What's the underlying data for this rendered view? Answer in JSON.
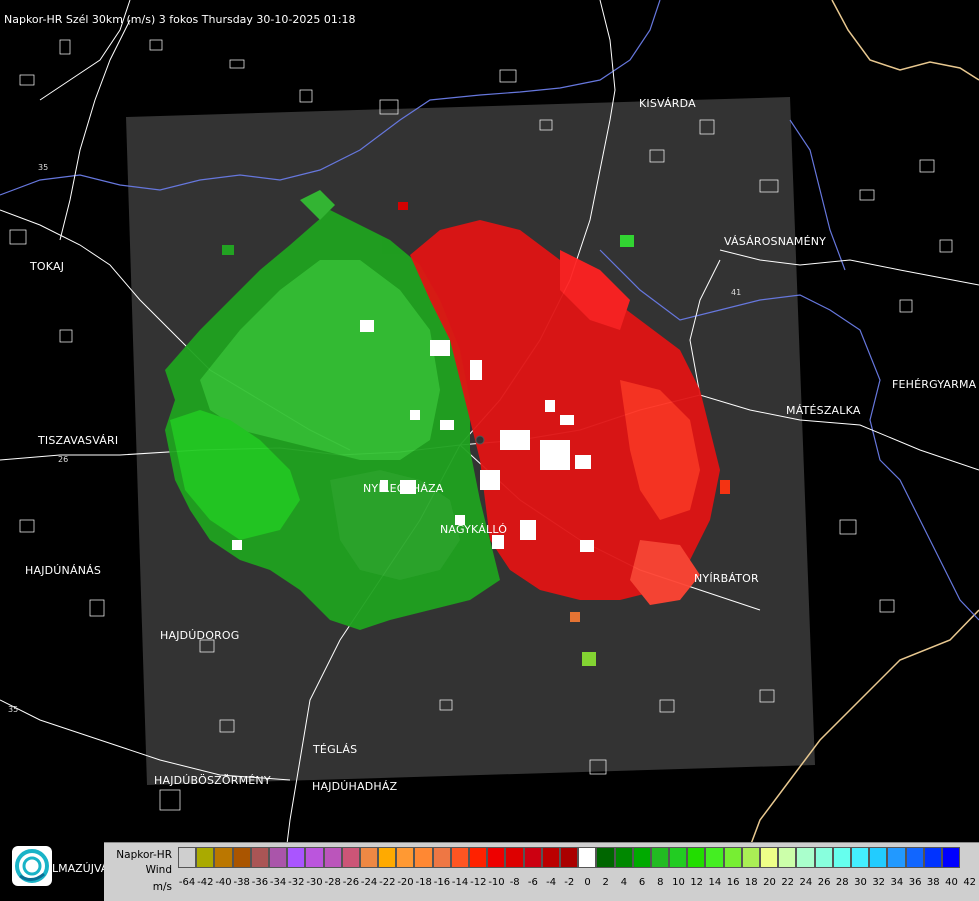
{
  "header": {
    "title": "Napkor-HR Szél 30km (m/s) 3 fokos Thursday 30-10-2025 01:18"
  },
  "cities": [
    {
      "id": "kisvarda",
      "label": "KISVÁRDA"
    },
    {
      "id": "tokaj",
      "label": "TOKAJ"
    },
    {
      "id": "vasarosnameny",
      "label": "VÁSÁROSNAMÉNY"
    },
    {
      "id": "fehergyarmat",
      "label": "FEHÉRGYARMA"
    },
    {
      "id": "mateszalka",
      "label": "MÁTÉSZALKA"
    },
    {
      "id": "tiszavasvari",
      "label": "TISZAVASVÁRI"
    },
    {
      "id": "nyiregyhaza",
      "label": "NYÍREGYHÁZA"
    },
    {
      "id": "nagykallo",
      "label": "NAGYKÁLLÓ"
    },
    {
      "id": "hajdunanas",
      "label": "HAJDÚNÁNÁS"
    },
    {
      "id": "nyirbator",
      "label": "NYÍRBÁTOR"
    },
    {
      "id": "hajdudorog",
      "label": "HAJDÚDOROG"
    },
    {
      "id": "teglas",
      "label": "TÉGLÁS"
    },
    {
      "id": "hajduboszormeny",
      "label": "HAJDÚBÖSZÖRMÉNY"
    },
    {
      "id": "hajduhadhaz",
      "label": "HAJDÚHADHÁZ"
    },
    {
      "id": "balmazujvaros",
      "label": "LMAZÚJVÁR"
    }
  ],
  "road_numbers": [
    "35",
    "26",
    "41",
    "35"
  ],
  "legend": {
    "line1": "Napkor-HR",
    "line2": "Wind",
    "line3": "m/s",
    "ticks": [
      "-64",
      "-42",
      "-40",
      "-38",
      "-36",
      "-34",
      "-32",
      "-30",
      "-28",
      "-26",
      "-24",
      "-22",
      "-20",
      "-18",
      "-16",
      "-14",
      "-12",
      "-10",
      "-8",
      "-6",
      "-4",
      "-2",
      "0",
      "2",
      "4",
      "6",
      "8",
      "10",
      "12",
      "14",
      "16",
      "18",
      "20",
      "22",
      "24",
      "26",
      "28",
      "30",
      "32",
      "34",
      "36",
      "38",
      "40",
      "42"
    ],
    "colors": [
      "#cfcfcf",
      "#aaaa00",
      "#bb7700",
      "#aa5500",
      "#aa5555",
      "#aa55aa",
      "#aa55ff",
      "#bb55dd",
      "#bb55bb",
      "#cc5577",
      "#ee8844",
      "#ffaa00",
      "#ff9933",
      "#ff8833",
      "#ee7744",
      "#ff5522",
      "#ff2200",
      "#ee0000",
      "#dd0000",
      "#cc0011",
      "#bb0000",
      "#aa0000",
      "#ffffff",
      "#006600",
      "#008800",
      "#00aa00",
      "#22bb22",
      "#22cc22",
      "#22dd00",
      "#44ee22",
      "#77ee33",
      "#aaee55",
      "#eeff88",
      "#ccffaa",
      "#aaffcc",
      "#88ffdd",
      "#66ffee",
      "#44eeff",
      "#22ccff",
      "#2299ff",
      "#1166ff",
      "#0033ff",
      "#0000ff"
    ]
  }
}
